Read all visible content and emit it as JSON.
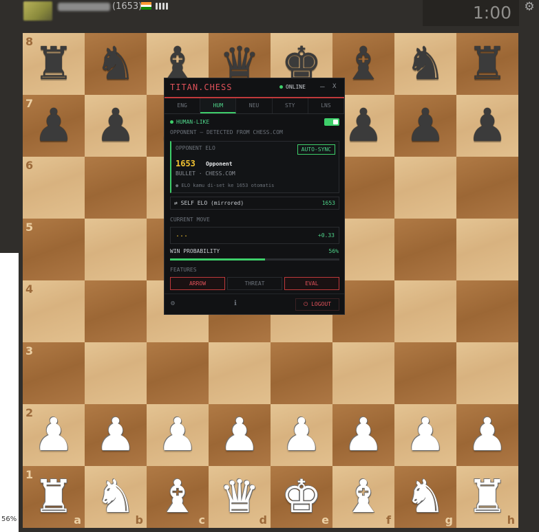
{
  "top_bar": {
    "opponent_rating": "(1653)",
    "clock": "1:00",
    "settings_icon": "gear-icon",
    "flag_colors": [
      "#ff9933",
      "#ffffff",
      "#138808"
    ]
  },
  "zoom_level": "56%",
  "board": {
    "rank_labels": [
      "8",
      "7",
      "6",
      "5",
      "4",
      "3",
      "2",
      "1"
    ],
    "file_labels": [
      "a",
      "b",
      "c",
      "d",
      "e",
      "f",
      "g",
      "h"
    ],
    "position": [
      [
        "br",
        "bn",
        "bb",
        "bq",
        "bk",
        "bb",
        "bn",
        "br"
      ],
      [
        "bp",
        "bp",
        "bp",
        "bp",
        "bp",
        "bp",
        "bp",
        "bp"
      ],
      [
        "",
        "",
        "",
        "",
        "",
        "",
        "",
        ""
      ],
      [
        "",
        "",
        "",
        "",
        "",
        "",
        "",
        ""
      ],
      [
        "",
        "",
        "",
        "",
        "",
        "",
        "",
        ""
      ],
      [
        "",
        "",
        "",
        "",
        "",
        "",
        "",
        ""
      ],
      [
        "wp",
        "wp",
        "wp",
        "wp",
        "wp",
        "wp",
        "wp",
        "wp"
      ],
      [
        "wr",
        "wn",
        "wb",
        "wq",
        "wk",
        "wb",
        "wn",
        "wr"
      ]
    ]
  },
  "panel": {
    "title": "TITAN.CHESS",
    "status": "ONLINE",
    "minimize": "—",
    "close": "X",
    "tabs": [
      "ENG",
      "HUM",
      "NEU",
      "STY",
      "LNS"
    ],
    "active_tab": "HUM",
    "mode_label": "HUMAN-LIKE",
    "mode_enabled": true,
    "opponent_detected": "OPPONENT — DETECTED FROM CHESS.COM",
    "opponent_elo_label": "OPPONENT ELO",
    "auto_sync": "AUTO-SYNC",
    "opponent_elo": "1653",
    "opponent_name": "Opponent",
    "opponent_meta": "BULLET · CHESS.COM",
    "elo_note": "● ELO kamu di-set ke 1653 otomatis",
    "self_elo_label": "⇄ SELF ELO (mirrored)",
    "self_elo_value": "1653",
    "current_move_label": "CURRENT MOVE",
    "current_move": "...",
    "eval": "+0.33",
    "win_prob_label": "WIN PROBABILITY",
    "win_prob": "56%",
    "win_prob_fraction": 0.56,
    "features_label": "FEATURES",
    "features": [
      {
        "label": "ARROW",
        "on": true
      },
      {
        "label": "THREAT",
        "on": false
      },
      {
        "label": "EVAL",
        "on": true
      }
    ],
    "logout": "⏻ LOGOUT",
    "accent_green": "#3ecf6a",
    "accent_red": "#e0525a"
  }
}
